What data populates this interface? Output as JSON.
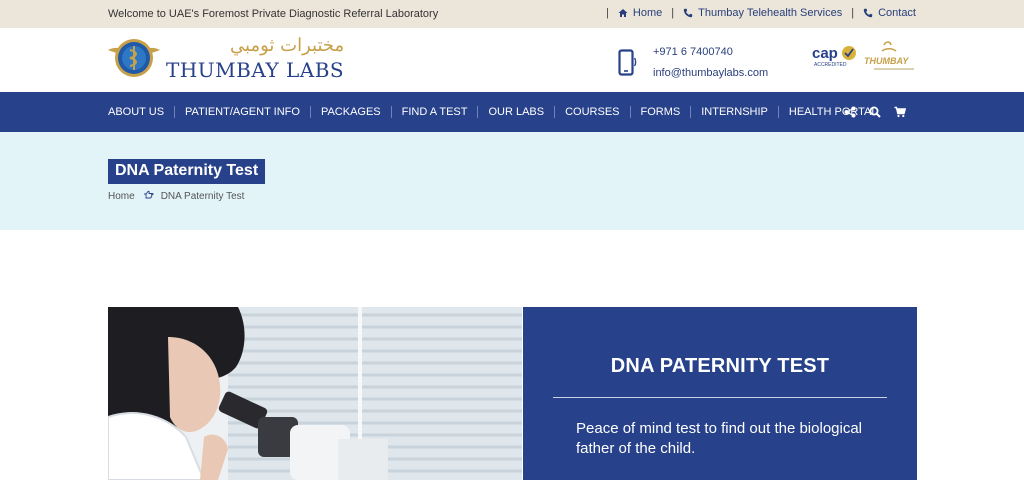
{
  "topbar": {
    "welcome": "Welcome to UAE's Foremost Private Diagnostic Referral Laboratory",
    "links": [
      {
        "label": "Home",
        "icon": "home-icon"
      },
      {
        "label": "Thumbay Telehealth Services",
        "icon": "phone-icon"
      },
      {
        "label": "Contact",
        "icon": "phone-icon"
      }
    ]
  },
  "header": {
    "logo_arabic": "مختبرات ثومبي",
    "logo_text": "THUMBAY LABS",
    "phone": "+971 6 7400740",
    "email": "info@thumbaylabs.com",
    "badge_cap": "cap",
    "badge_cap_sub": "ACCREDITED",
    "badge_thumbay": "THUMBAY"
  },
  "nav": {
    "items": [
      "ABOUT US",
      "PATIENT/AGENT INFO",
      "PACKAGES",
      "FIND A TEST",
      "OUR LABS",
      "COURSES",
      "FORMS",
      "INTERNSHIP",
      "HEALTH PORTAL"
    ],
    "icons": [
      "share-icon",
      "search-icon",
      "cart-icon"
    ]
  },
  "page": {
    "title": "DNA Paternity Test",
    "breadcrumb": [
      "Home",
      "DNA Paternity Test"
    ]
  },
  "hero": {
    "title": "DNA PATERNITY TEST",
    "description": "Peace of mind test to find out the biological father of the child."
  },
  "colors": {
    "brand_blue": "#27418a",
    "topbar_bg": "#ece5da",
    "title_band_bg": "#e2f4f8",
    "gold": "#c7a04a"
  }
}
